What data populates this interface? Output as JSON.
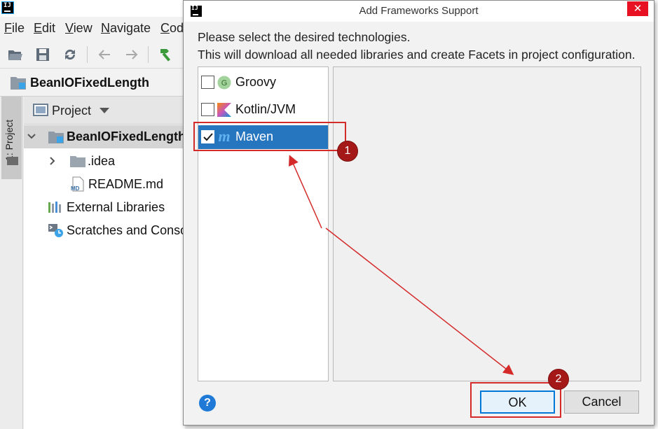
{
  "ide": {
    "logo_text": "IJ",
    "menu": [
      "File",
      "Edit",
      "View",
      "Navigate",
      "Cod"
    ],
    "nav_title": "BeanIOFixedLength",
    "side_tab_label": "1: Project",
    "project_header_label": "Project",
    "tree": {
      "root": "BeanIOFixedLength",
      "idea": ".idea",
      "readme": "README.md",
      "readme_badge": "MD",
      "external_libraries": "External Libraries",
      "scratches": "Scratches and Conso"
    }
  },
  "dialog": {
    "logo_text": "IJ",
    "title": "Add Frameworks Support",
    "close_glyph": "✕",
    "description_line1": "Please select the desired technologies.",
    "description_line2": "This will download all needed libraries and create Facets in project configuration.",
    "technologies": [
      {
        "label": "Groovy",
        "checked": false,
        "icon": "groovy-icon",
        "icon_text": "G"
      },
      {
        "label": "Kotlin/JVM",
        "checked": false,
        "icon": "kotlin-icon"
      },
      {
        "label": "Maven",
        "checked": true,
        "selected": true,
        "icon": "maven-icon",
        "icon_text": "m"
      }
    ],
    "help_glyph": "?",
    "ok_label": "OK",
    "cancel_label": "Cancel"
  },
  "annotations": {
    "badge1": "1",
    "badge2": "2"
  },
  "colors": {
    "selection": "#2675bf",
    "annotation_red": "#d42a2a",
    "badge": "#a51818",
    "ok_focus": "#0078d7"
  }
}
